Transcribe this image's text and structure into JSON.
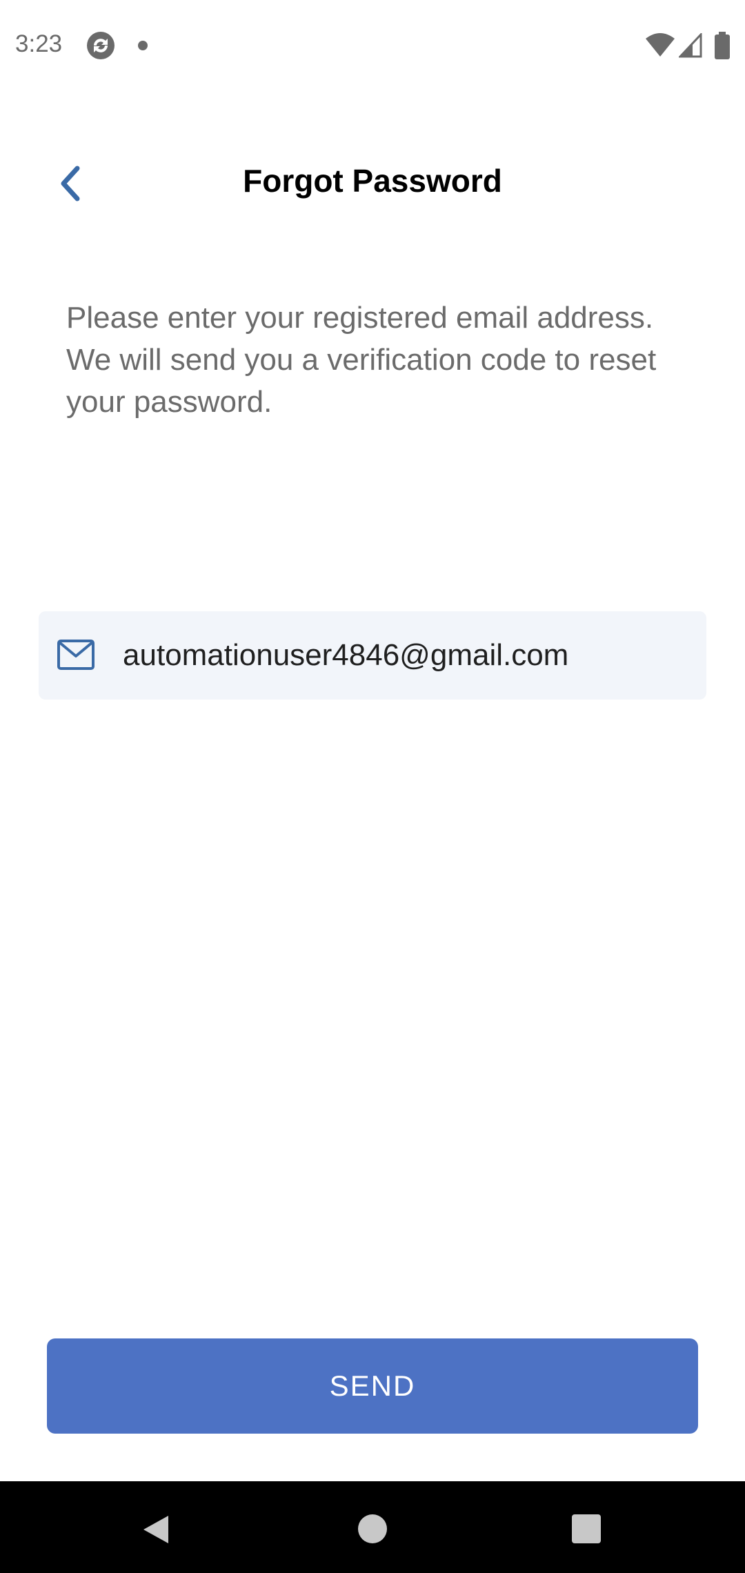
{
  "status_bar": {
    "time": "3:23",
    "icons": [
      "app-sync-icon",
      "notification-dot-icon",
      "wifi-icon",
      "signal-icon",
      "battery-icon"
    ]
  },
  "header": {
    "title": "Forgot Password",
    "back_icon": "chevron-left-icon"
  },
  "instructions": "Please enter your registered email address. We will send you a verification code to reset your password.",
  "email_field": {
    "icon": "mail-icon",
    "value": "automationuser4846@gmail.com"
  },
  "send_button": {
    "label": "SEND"
  },
  "nav_bar": {
    "icons": [
      "nav-back-icon",
      "nav-home-icon",
      "nav-recents-icon"
    ]
  },
  "colors": {
    "accent": "#4d72c4",
    "back_chevron": "#3a6aa6",
    "field_bg": "#f2f5fa",
    "instruction_text": "#6b6b6b"
  }
}
